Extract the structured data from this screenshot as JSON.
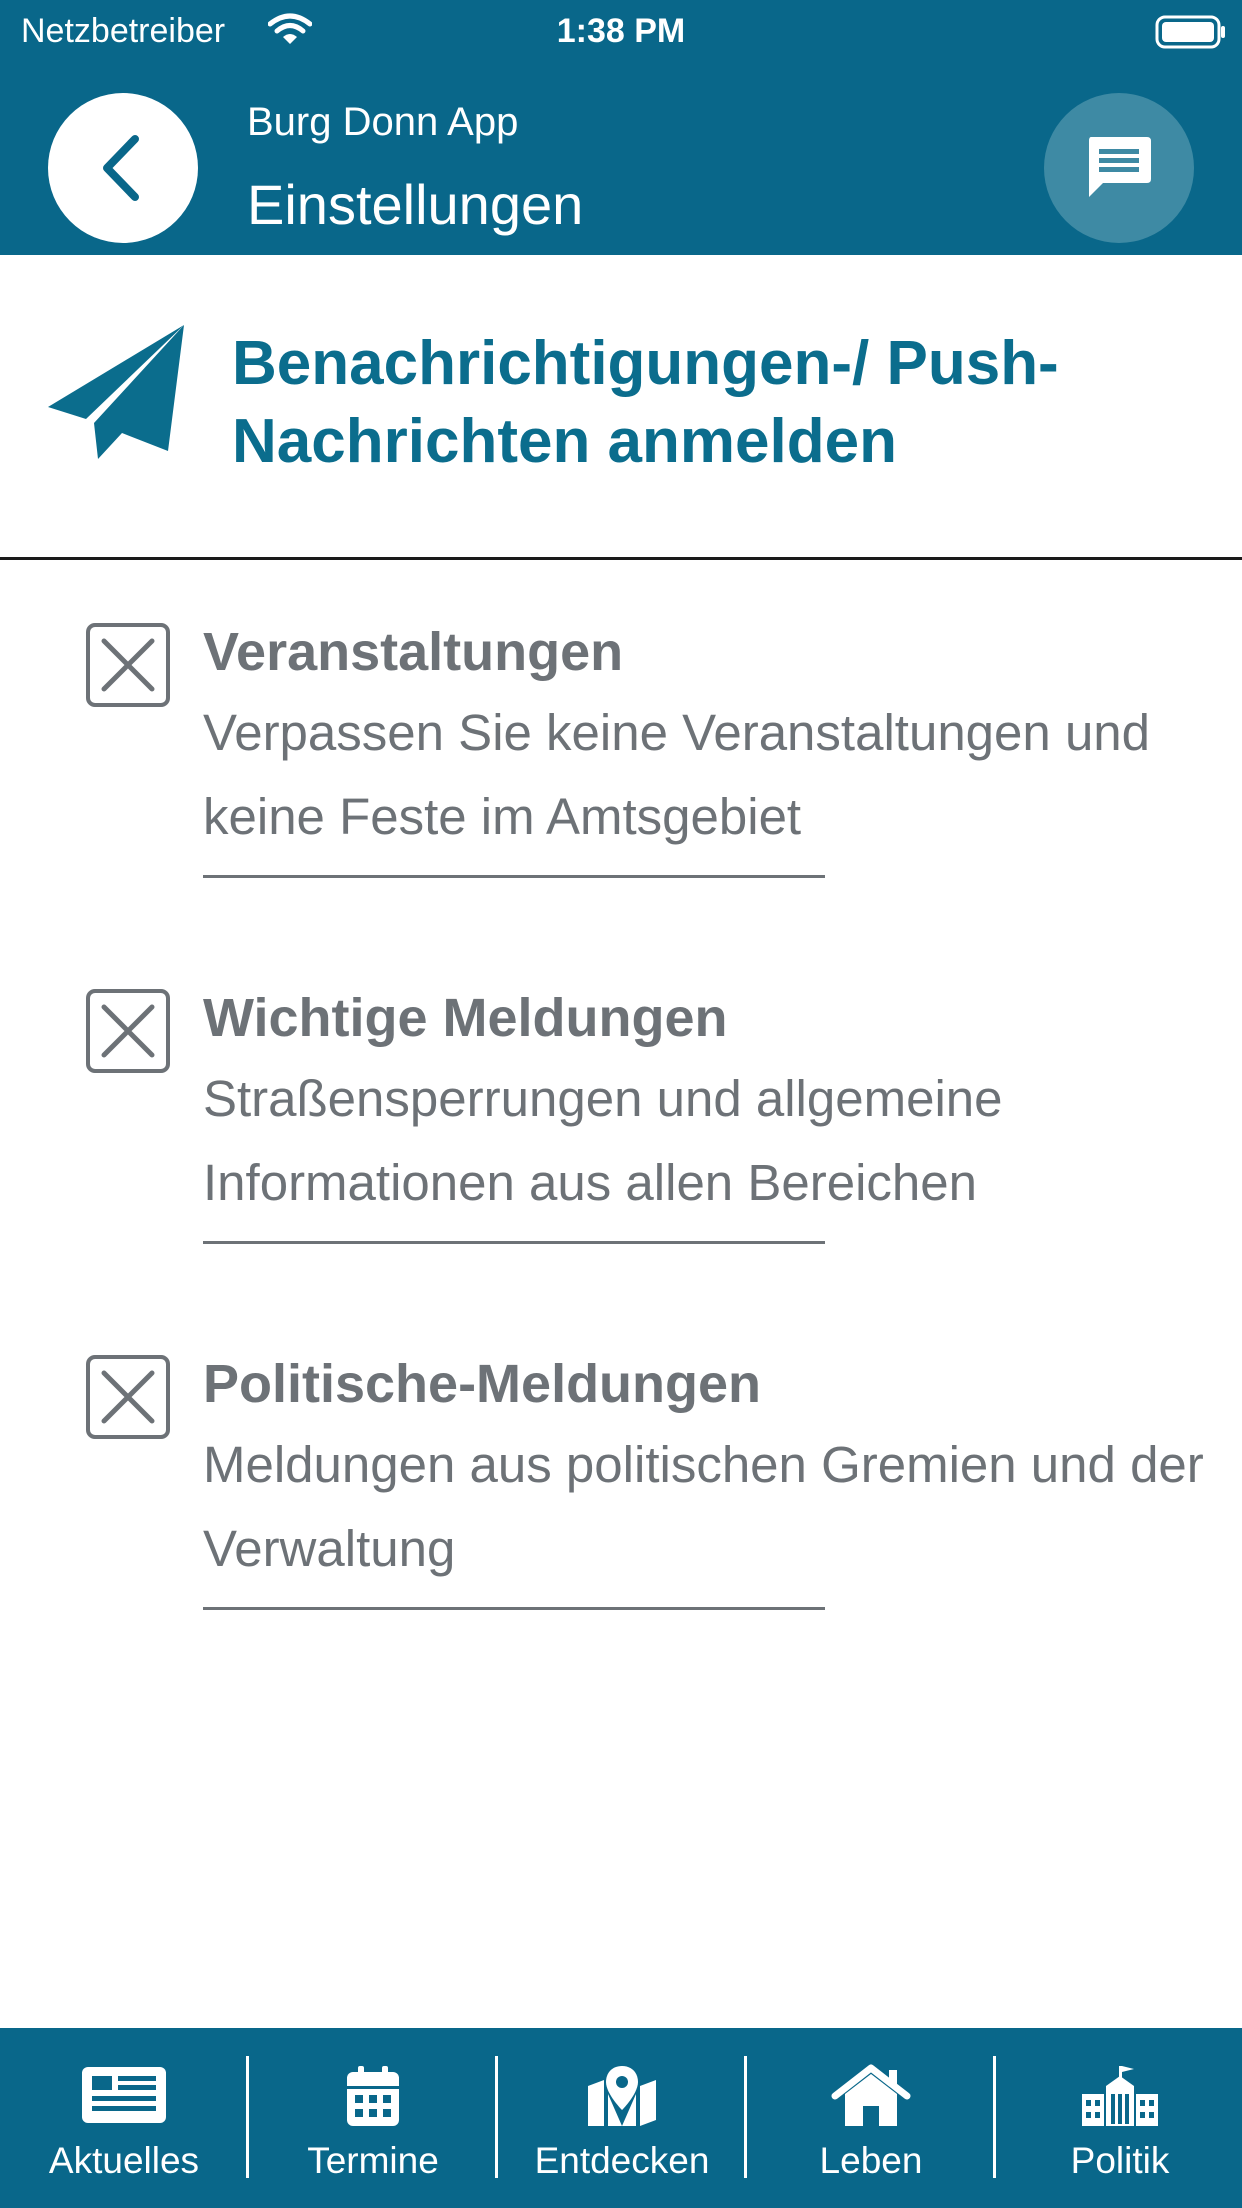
{
  "status_bar": {
    "carrier": "Netzbetreiber",
    "time": "1:38 PM"
  },
  "header": {
    "subtitle": "Burg Donn App",
    "title": "Einstellungen"
  },
  "section": {
    "title": "Benachrichtigungen-/ Push-Nachrichten anmelden"
  },
  "options": [
    {
      "title": "Veranstaltungen",
      "description": "Verpassen Sie keine Veranstaltungen und keine Feste im Amtsgebiet",
      "checked": true
    },
    {
      "title": "Wichtige Meldungen",
      "description": "Straßensperrungen und allgemeine Informationen aus allen Bereichen",
      "checked": true
    },
    {
      "title": "Politische-Meldungen",
      "description": "Meldungen aus politischen Gremien und der Verwaltung",
      "checked": true
    }
  ],
  "tabs": [
    {
      "label": "Aktuelles",
      "icon": "newspaper-icon"
    },
    {
      "label": "Termine",
      "icon": "calendar-icon"
    },
    {
      "label": "Entdecken",
      "icon": "map-pin-icon"
    },
    {
      "label": "Leben",
      "icon": "home-icon"
    },
    {
      "label": "Politik",
      "icon": "town-hall-icon"
    }
  ],
  "colors": {
    "primary": "#09678a",
    "accent": "#0b6d8d",
    "text_gray": "#6d7277"
  }
}
